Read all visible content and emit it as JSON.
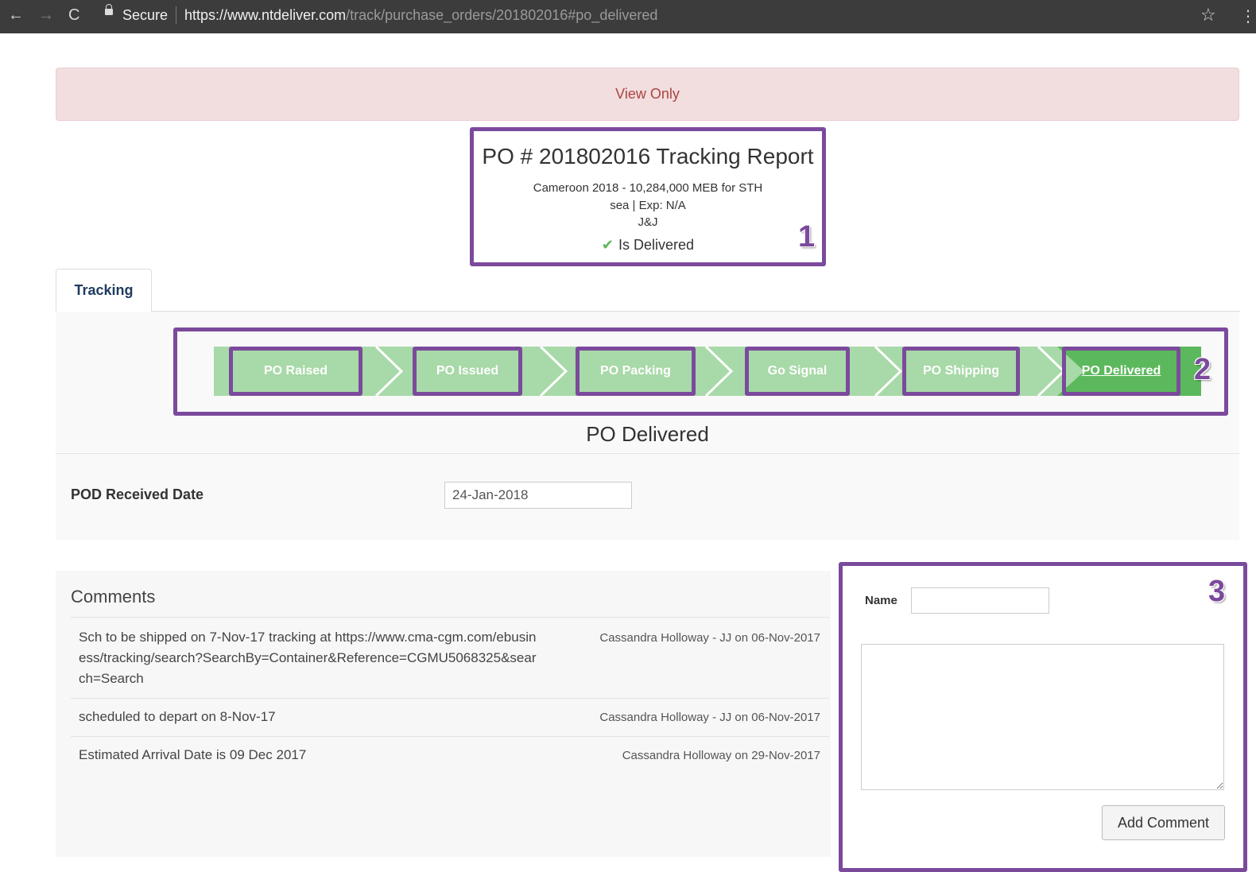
{
  "browser": {
    "secure_label": "Secure",
    "url_host": "https://www.ntdeliver.com",
    "url_path": "/track/purchase_orders/201802016#po_delivered",
    "back_icon": "←",
    "forward_icon": "→",
    "reload_icon": "C",
    "star_icon": "☆",
    "menu_icon": "⋮"
  },
  "banner": {
    "text": "View Only"
  },
  "report": {
    "title": "PO # 201802016 Tracking Report",
    "line1": "Cameroon 2018 - 10,284,000 MEB for STH",
    "line2": "sea | Exp: N/A",
    "line3": "J&J",
    "status_check": "✔",
    "status": "Is Delivered"
  },
  "callouts": {
    "one": "1",
    "two": "2",
    "three": "3"
  },
  "tabs": [
    {
      "label": "Tracking"
    }
  ],
  "steps": [
    {
      "label": "PO Raised"
    },
    {
      "label": "PO Issued"
    },
    {
      "label": "PO Packing"
    },
    {
      "label": "Go Signal"
    },
    {
      "label": "PO Shipping"
    },
    {
      "label": "PO Delivered"
    }
  ],
  "stage": {
    "title": "PO Delivered"
  },
  "pod": {
    "label": "POD Received Date",
    "value": "24-Jan-2018"
  },
  "comments": {
    "title": "Comments",
    "items": [
      {
        "text": "Sch to be shipped on 7-Nov-17 tracking at https://www.cma-cgm.com/ebusiness/tracking/search?SearchBy=Container&Reference=CGMU5068325&search=Search",
        "meta": "Cassandra Holloway - JJ on 06-Nov-2017"
      },
      {
        "text": "scheduled to depart on 8-Nov-17",
        "meta": "Cassandra Holloway - JJ on 06-Nov-2017"
      },
      {
        "text": "Estimated Arrival Date is 09 Dec 2017",
        "meta": "Cassandra Holloway on 29-Nov-2017"
      }
    ]
  },
  "form": {
    "name_label": "Name",
    "name_value": "",
    "comment_value": "",
    "submit_label": "Add Comment"
  },
  "colors": {
    "accent_outline": "#7b4a9c",
    "step_light": "#a8d9a8",
    "step_active": "#5cb85c",
    "banner_bg": "#f2dede",
    "banner_text": "#a94442"
  }
}
